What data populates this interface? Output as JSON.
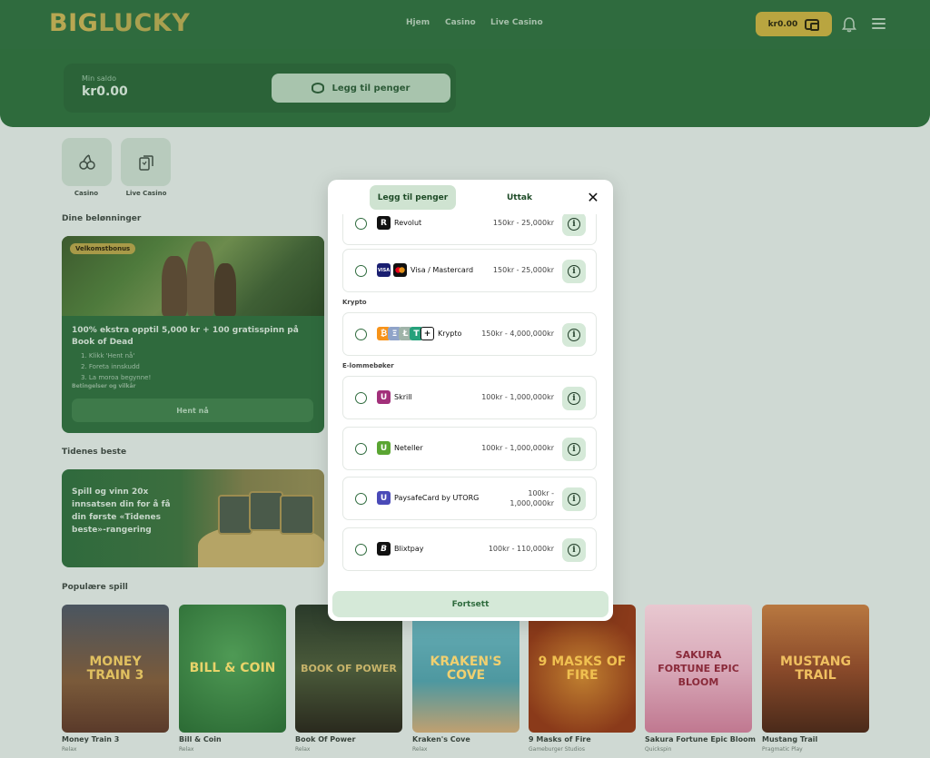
{
  "header": {
    "logo_big": "BIG",
    "logo_lucky": "LUCKY",
    "nav": [
      "Hjem",
      "Casino",
      "Live Casino"
    ],
    "wallet_balance": "kr0.00"
  },
  "balance": {
    "label": "Min saldo",
    "value": "kr0.00",
    "add_money_label": "Legg til penger"
  },
  "categories": [
    {
      "label": "Casino"
    },
    {
      "label": "Live Casino"
    }
  ],
  "rewards": {
    "section_title": "Dine belønninger",
    "badge": "Velkomstbonus",
    "title": "100% ekstra opptil 5,000 kr + 100 gratisspinn på Book of Dead",
    "steps": [
      "1. Klikk 'Hent nå'",
      "2. Foreta innskudd",
      "3. La moroa begynne!"
    ],
    "terms": "Betingelser og vilkår",
    "claim_label": "Hent nå"
  },
  "beste": {
    "section_title": "Tidenes beste",
    "text": "Spill og vinn 20x innsatsen din for å få din første «Tidenes beste»-rangering"
  },
  "popular": {
    "section_title": "Populære spill",
    "games": [
      {
        "title": "Money Train 3",
        "provider": "Relax",
        "art": "MONEY TRAIN 3"
      },
      {
        "title": "Bill & Coin",
        "provider": "Relax",
        "art": "BILL & COIN"
      },
      {
        "title": "Book Of Power",
        "provider": "Relax",
        "art": "BOOK OF POWER"
      },
      {
        "title": "Kraken's Cove",
        "provider": "Relax",
        "art": "KRAKEN'S COVE"
      },
      {
        "title": "9 Masks of Fire",
        "provider": "Gameburger Studios",
        "art": "9 MASKS OF FIRE"
      },
      {
        "title": "Sakura Fortune Epic Bloom",
        "provider": "Quickspin",
        "art": "SAKURA FORTUNE EPIC BLOOM"
      },
      {
        "title": "Mustang Trail",
        "provider": "Pragmatic Play",
        "art": "MUSTANG TRAIL"
      }
    ]
  },
  "modal": {
    "tab_deposit": "Legg til penger",
    "tab_withdraw": "Uttak",
    "close_symbol": "✕",
    "group_crypto": "Krypto",
    "group_ewallets": "E-lommebøker",
    "methods": [
      {
        "name": "Revolut",
        "range": "150kr - 25,000kr"
      },
      {
        "name": "Visa / Mastercard",
        "range": "150kr - 25,000kr"
      },
      {
        "name": "Krypto",
        "range": "150kr - 4,000,000kr"
      },
      {
        "name": "Skrill",
        "range": "100kr - 1,000,000kr"
      },
      {
        "name": "Neteller",
        "range": "100kr - 1,000,000kr"
      },
      {
        "name": "PaysafeCard by UTORG",
        "range_line1": "100kr -",
        "range_line2": "1,000,000kr"
      },
      {
        "name": "Blixtpay",
        "range": "100kr - 110,000kr"
      }
    ],
    "continue_label": "Fortsett"
  }
}
